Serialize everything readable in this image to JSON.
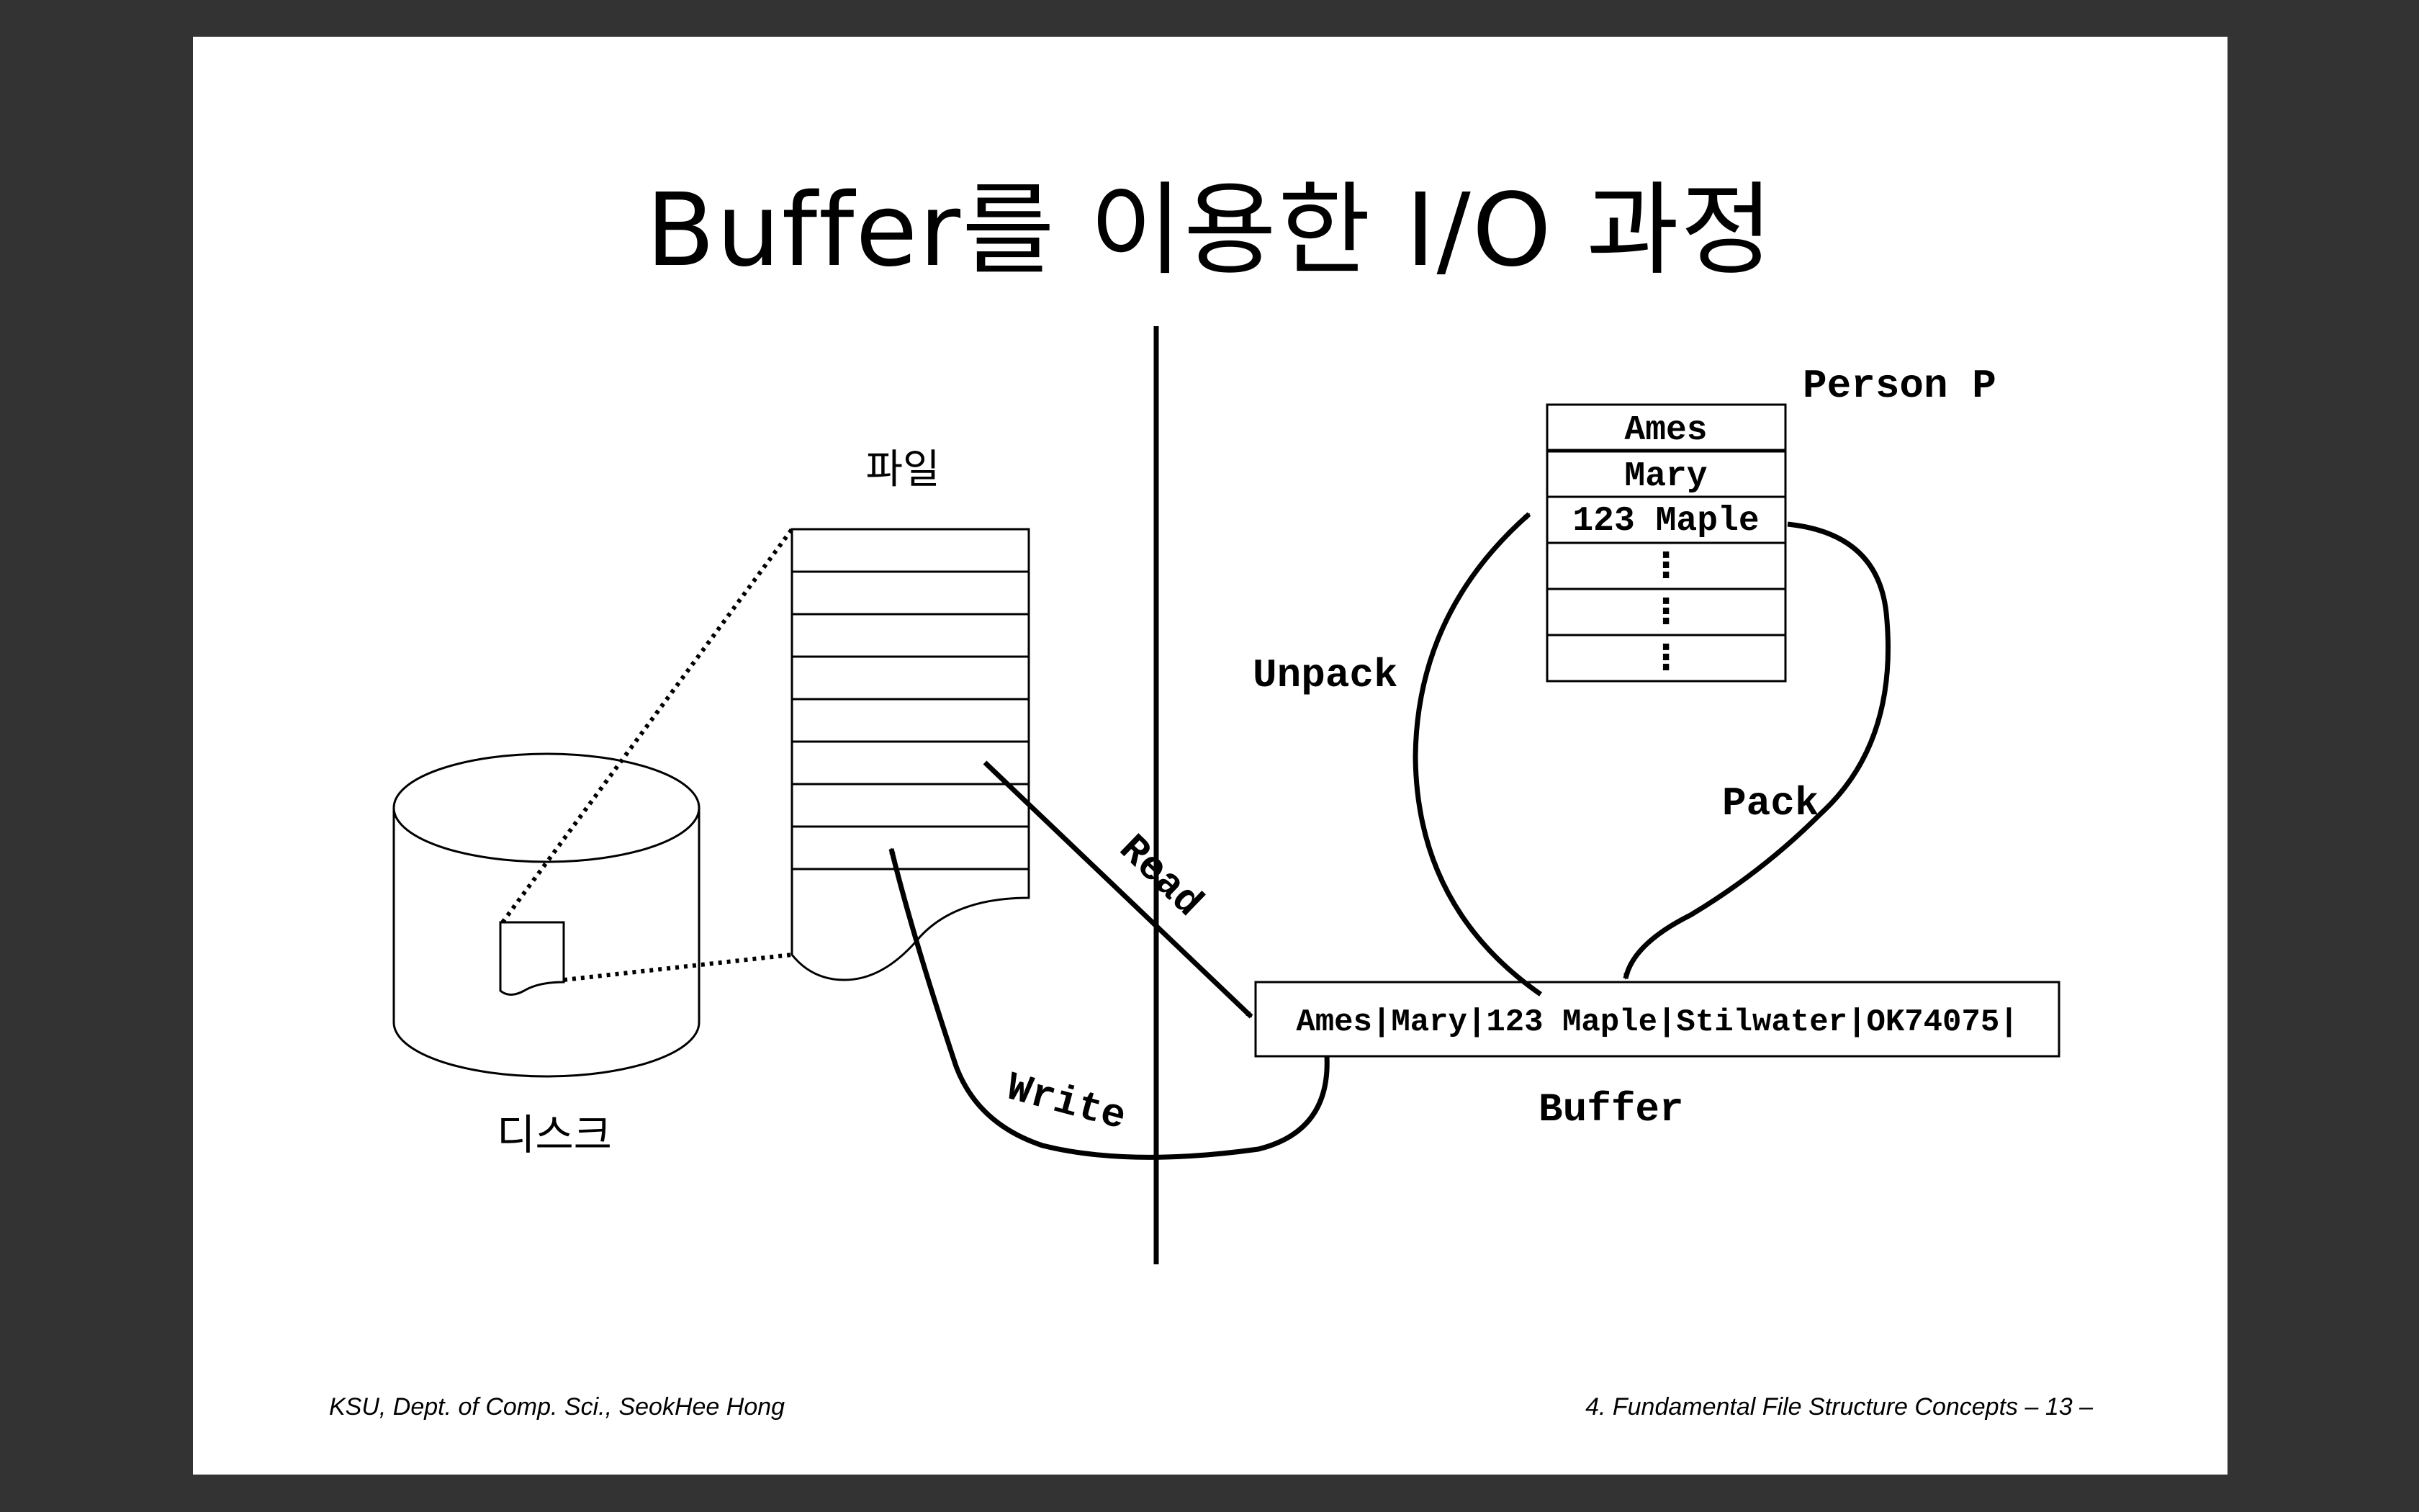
{
  "slide": {
    "title": "Buffer를 이용한 I/O 과정",
    "footer_left": "KSU, Dept. of Comp. Sci., SeokHee Hong",
    "footer_right": "4. Fundamental File Structure Concepts   – 13 –"
  },
  "diagram": {
    "disk_label": "디스크",
    "file_label": "파일",
    "person_label": "Person P",
    "person_fields": [
      "Ames",
      "Mary",
      "123 Maple",
      "⋮",
      "⋮",
      "⋮"
    ],
    "buffer_content": "Ames|Mary|123 Maple|Stilwater|OK74075|",
    "buffer_label": "Buffer",
    "arrows": {
      "read": "Read",
      "write": "Write",
      "unpack": "Unpack",
      "pack": "Pack"
    }
  }
}
